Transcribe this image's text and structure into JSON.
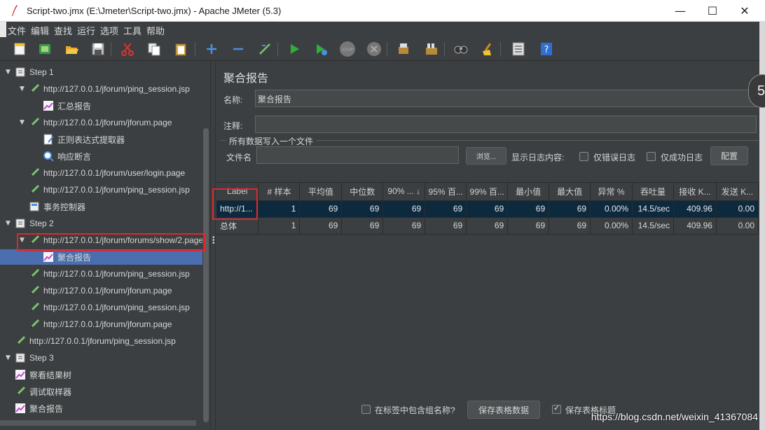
{
  "window": {
    "title": "Script-two.jmx (E:\\Jmeter\\Script-two.jmx) - Apache JMeter (5.3)",
    "controls": [
      "—",
      "☐",
      "✕"
    ]
  },
  "menu": [
    "文件",
    "编辑",
    "查找",
    "运行",
    "选项",
    "工具",
    "帮助"
  ],
  "toolbar": {
    "icons": [
      "new-icon",
      "templates-icon",
      "open-icon",
      "save-icon",
      "cut-icon",
      "copy-icon",
      "paste-icon",
      "expand-icon",
      "collapse-icon",
      "toggle-icon",
      "start-icon",
      "start-no-pause-icon",
      "stop-icon",
      "shutdown-icon",
      "clear-icon",
      "clear-all-icon",
      "search-icon",
      "reset-search-icon",
      "function-helper-icon",
      "help-icon"
    ]
  },
  "tree": {
    "nodes": [
      {
        "label": "Step 1",
        "type": "thread-group",
        "expanded": true
      },
      {
        "label": "http://127.0.0.1/jforum/ping_session.jsp",
        "type": "sampler",
        "expanded": true
      },
      {
        "label": "汇总报告",
        "type": "listener"
      },
      {
        "label": "http://127.0.0.1/jforum/jforum.page",
        "type": "sampler",
        "expanded": true
      },
      {
        "label": "正则表达式提取器",
        "type": "extractor"
      },
      {
        "label": "响应断言",
        "type": "assertion"
      },
      {
        "label": "http://127.0.0.1/jforum/user/login.page",
        "type": "sampler"
      },
      {
        "label": "http://127.0.0.1/jforum/ping_session.jsp",
        "type": "sampler"
      },
      {
        "label": "事务控制器",
        "type": "controller"
      },
      {
        "label": "Step 2",
        "type": "thread-group",
        "expanded": true
      },
      {
        "label": "http://127.0.0.1/jforum/forums/show/2.page",
        "type": "sampler",
        "expanded": true
      },
      {
        "label": "聚合报告",
        "type": "listener",
        "selected": true
      },
      {
        "label": "http://127.0.0.1/jforum/ping_session.jsp",
        "type": "sampler"
      },
      {
        "label": "http://127.0.0.1/jforum/jforum.page",
        "type": "sampler"
      },
      {
        "label": "http://127.0.0.1/jforum/ping_session.jsp",
        "type": "sampler"
      },
      {
        "label": "http://127.0.0.1/jforum/jforum.page",
        "type": "sampler"
      },
      {
        "label": "http://127.0.0.1/jforum/ping_session.jsp",
        "type": "sampler"
      },
      {
        "label": "Step 3",
        "type": "thread-group",
        "expanded": true
      },
      {
        "label": "察看结果树",
        "type": "listener"
      },
      {
        "label": "调试取样器",
        "type": "sampler"
      },
      {
        "label": "聚合报告",
        "type": "listener"
      }
    ]
  },
  "panel": {
    "heading": "聚合报告",
    "name_label": "名称:",
    "name_value": "聚合报告",
    "comment_label": "注释:",
    "comment_value": "",
    "file_group_title": "所有数据写入一个文件",
    "file_label": "文件名",
    "file_value": "",
    "browse_button": "浏览...",
    "log_content_label": "显示日志内容:",
    "errors_only_label": "仅错误日志",
    "errors_only_checked": false,
    "success_only_label": "仅成功日志",
    "success_only_checked": false,
    "config_button": "配置"
  },
  "table": {
    "columns": [
      "Label",
      "# 样本",
      "平均值",
      "中位数",
      "90% ... ↓",
      "95% 百...",
      "99% 百...",
      "最小值",
      "最大值",
      "异常 %",
      "吞吐量",
      "接收 K...",
      "发送 K..."
    ],
    "rows": [
      [
        "http://1...",
        "1",
        "69",
        "69",
        "69",
        "69",
        "69",
        "69",
        "69",
        "0.00%",
        "14.5/sec",
        "409.96",
        "0.00"
      ],
      [
        "总体",
        "1",
        "69",
        "69",
        "69",
        "69",
        "69",
        "69",
        "69",
        "0.00%",
        "14.5/sec",
        "409.96",
        "0.00"
      ]
    ]
  },
  "bottom": {
    "include_group_label": "在标签中包含组名称?",
    "include_group_checked": false,
    "save_data_button": "保存表格数据",
    "save_header_label": "保存表格标题",
    "save_header_checked": true
  },
  "watermark": "https://blog.csdn.net/weixin_41367084",
  "badge": "5",
  "colors": {
    "background": "#3c3f41",
    "selection": "#4b6eaf",
    "table_selection": "#0d293e",
    "highlight": "#e0282e"
  }
}
